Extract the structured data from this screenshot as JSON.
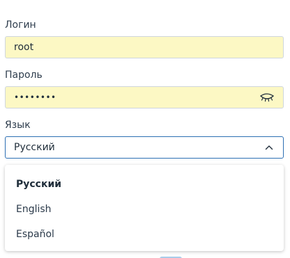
{
  "login": {
    "label": "Логин",
    "value": "root"
  },
  "password": {
    "label": "Пароль",
    "value": "••••••••",
    "toggle_icon": "eye-closed-icon"
  },
  "language": {
    "label": "Язык",
    "selected": "Русский",
    "expanded": true,
    "options": [
      {
        "label": "Русский",
        "selected": true
      },
      {
        "label": "English",
        "selected": false
      },
      {
        "label": "Español",
        "selected": false
      }
    ]
  },
  "colors": {
    "autofill_bg": "#fcf8c4",
    "focus_border": "#2d6fb3",
    "text": "#2b3a4a"
  }
}
